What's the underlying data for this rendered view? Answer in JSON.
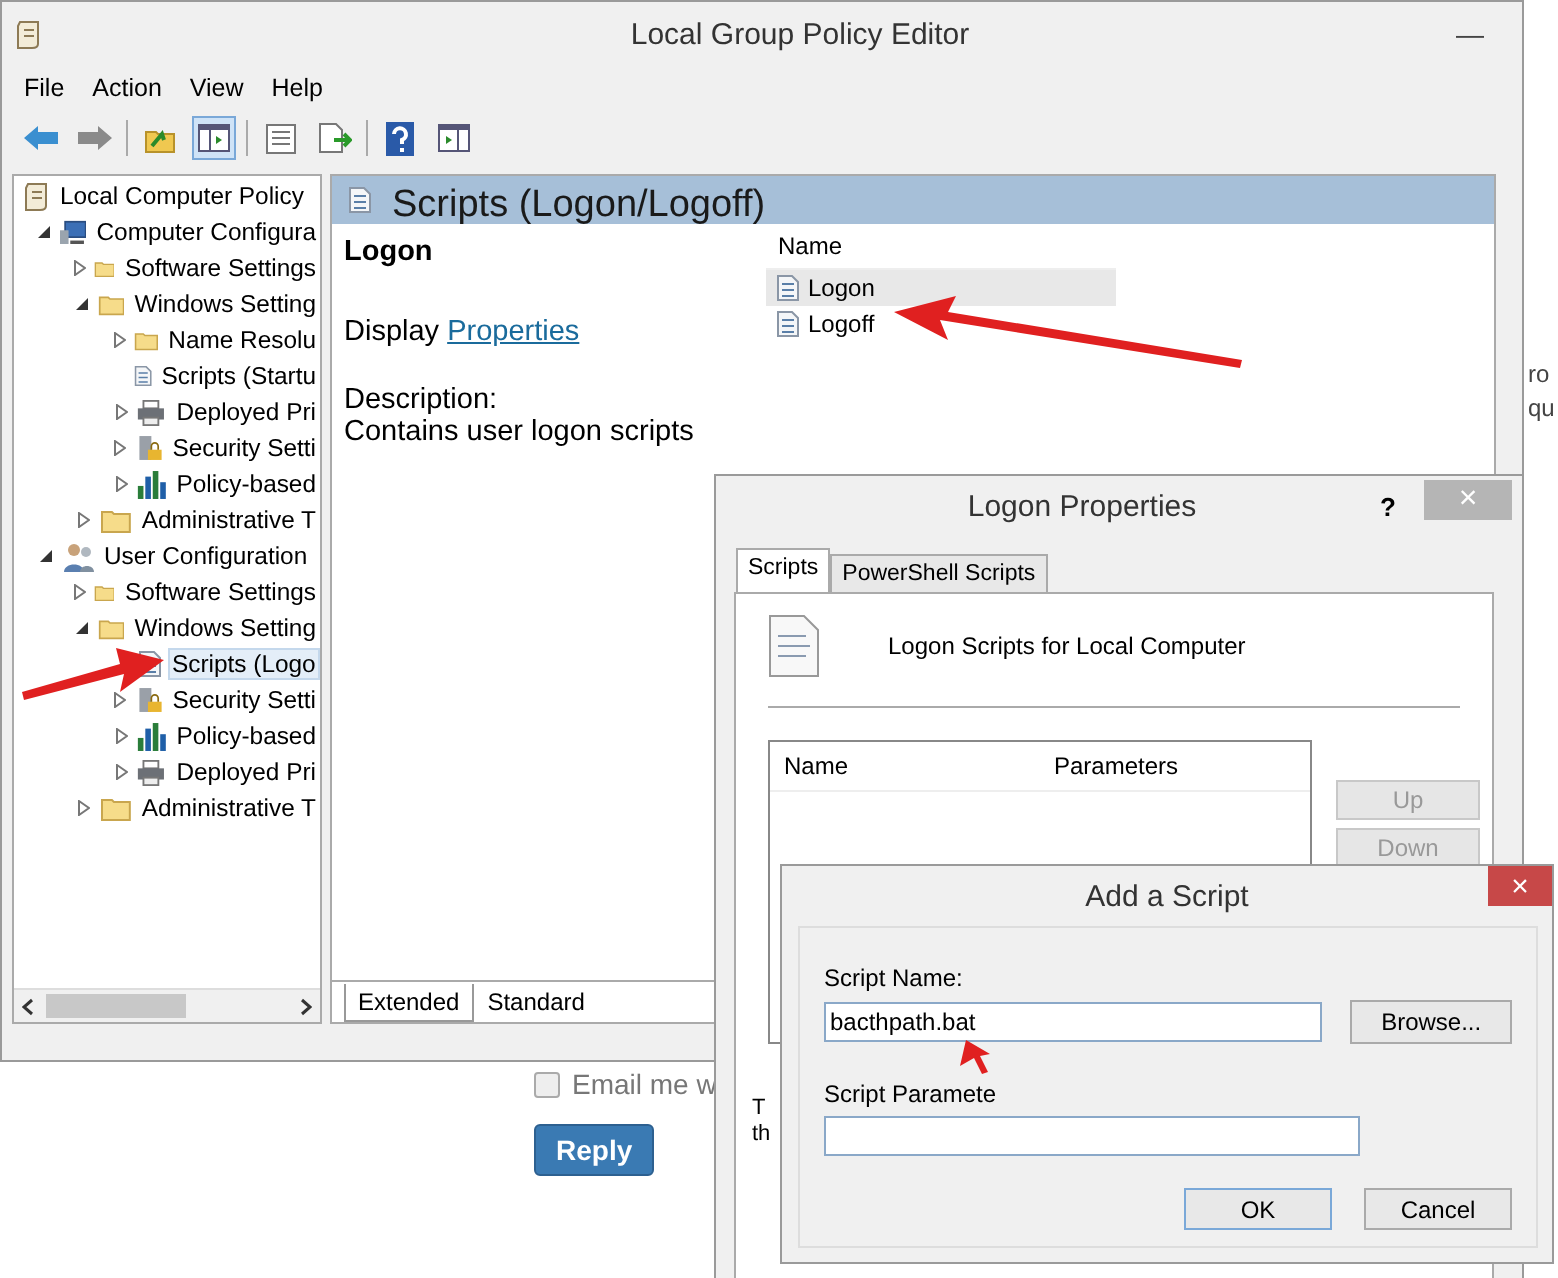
{
  "web_page": {
    "side_texts": [
      "ro",
      "qu"
    ],
    "email_checkbox": {
      "label": "Email me w",
      "checked": false
    },
    "reply_button": "Reply"
  },
  "window": {
    "title": "Local Group Policy Editor",
    "minimize": "—",
    "menu": [
      "File",
      "Action",
      "View",
      "Help"
    ],
    "toolbar": [
      {
        "kind": "back",
        "pressed": false
      },
      {
        "kind": "forward",
        "pressed": false
      },
      {
        "kind": "sep"
      },
      {
        "kind": "up",
        "pressed": false
      },
      {
        "kind": "tree",
        "pressed": true
      },
      {
        "kind": "sep"
      },
      {
        "kind": "props",
        "pressed": false
      },
      {
        "kind": "export",
        "pressed": false
      },
      {
        "kind": "sep"
      },
      {
        "kind": "help",
        "pressed": false
      },
      {
        "kind": "console",
        "pressed": false
      }
    ],
    "tree": [
      {
        "label": "Local Computer Policy",
        "kind": "policy",
        "selected": false,
        "children": [
          {
            "label": "Computer Configura",
            "kind": "computer",
            "expanded": true,
            "selected": false,
            "children": [
              {
                "label": "Software Settings",
                "kind": "folder",
                "expanded": false,
                "selected": false
              },
              {
                "label": "Windows Setting",
                "kind": "folder",
                "expanded": true,
                "selected": false,
                "children": [
                  {
                    "label": "Name Resolu",
                    "kind": "folder",
                    "expanded": false,
                    "selected": false
                  },
                  {
                    "label": "Scripts (Startu",
                    "kind": "script",
                    "selected": false
                  },
                  {
                    "label": "Deployed Pri",
                    "kind": "printer",
                    "expanded": false,
                    "selected": false
                  },
                  {
                    "label": "Security Setti",
                    "kind": "security",
                    "expanded": false,
                    "selected": false
                  },
                  {
                    "label": "Policy-based",
                    "kind": "chart",
                    "expanded": false,
                    "selected": false
                  }
                ]
              },
              {
                "label": "Administrative T",
                "kind": "folder",
                "expanded": false,
                "selected": false
              }
            ]
          },
          {
            "label": "User Configuration",
            "kind": "user",
            "expanded": true,
            "selected": false,
            "children": [
              {
                "label": "Software Settings",
                "kind": "folder",
                "expanded": false,
                "selected": false
              },
              {
                "label": "Windows Setting",
                "kind": "folder",
                "expanded": true,
                "selected": false,
                "children": [
                  {
                    "label": "Scripts (Logo",
                    "kind": "script",
                    "selected": true
                  },
                  {
                    "label": "Security Setti",
                    "kind": "security",
                    "expanded": false,
                    "selected": false
                  },
                  {
                    "label": "Policy-based",
                    "kind": "chart",
                    "expanded": false,
                    "selected": false
                  },
                  {
                    "label": "Deployed Pri",
                    "kind": "printer",
                    "expanded": false,
                    "selected": false
                  }
                ]
              },
              {
                "label": "Administrative T",
                "kind": "folder",
                "expanded": false,
                "selected": false
              }
            ]
          }
        ]
      }
    ],
    "details": {
      "header": "Scripts (Logon/Logoff)",
      "item_title": "Logon",
      "display_label": "Display",
      "properties_link": "Properties",
      "description_label": "Description:",
      "description": "Contains user logon scripts",
      "list": {
        "column": "Name",
        "rows": [
          {
            "name": "Logon",
            "selected": true
          },
          {
            "name": "Logoff",
            "selected": false
          }
        ]
      },
      "tabs": [
        {
          "label": "Extended",
          "selected": true
        },
        {
          "label": "Standard",
          "selected": false
        }
      ]
    }
  },
  "logon_properties": {
    "title": "Logon Properties",
    "help": "?",
    "close": "×",
    "tabs": [
      {
        "label": "Scripts",
        "selected": true
      },
      {
        "label": "PowerShell Scripts",
        "selected": false
      }
    ],
    "heading": "Logon Scripts for Local Computer",
    "columns": [
      "Name",
      "Parameters"
    ],
    "buttons": [
      {
        "label": "Up",
        "disabled": true
      },
      {
        "label": "Down",
        "disabled": true
      }
    ],
    "note_lines": [
      "T",
      "th"
    ]
  },
  "add_script": {
    "title": "Add a Script",
    "close": "×",
    "script_name": {
      "label": "Script Name:",
      "value": "bacthpath.bat"
    },
    "browse": "Browse...",
    "script_parameters": {
      "label": "Script Paramete"
    },
    "buttons": [
      "OK",
      "Cancel"
    ]
  }
}
